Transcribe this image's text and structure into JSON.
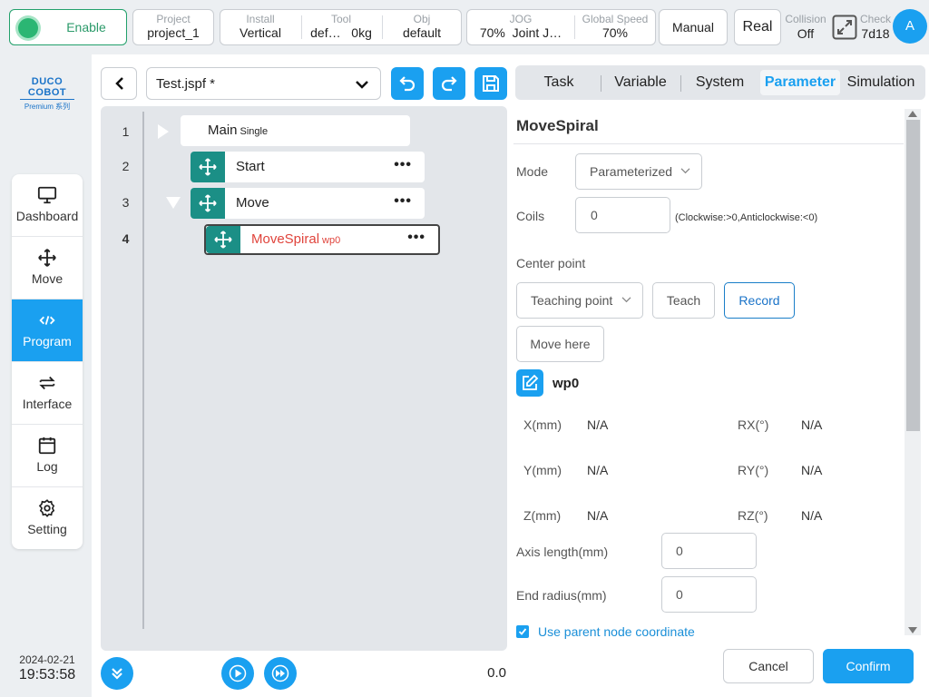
{
  "topbar": {
    "enable_label": "Enable",
    "project": {
      "title": "Project",
      "value": "project_1"
    },
    "install": {
      "title": "Install",
      "value": "Vertical"
    },
    "tool": {
      "title": "Tool",
      "value": "def…",
      "weight": "0kg"
    },
    "obj": {
      "title": "Obj",
      "value": "default"
    },
    "jog": {
      "title": "JOG",
      "value": "70%",
      "mode": "Joint J…"
    },
    "global_speed": {
      "title": "Global Speed",
      "value": "70%"
    },
    "manual_label": "Manual",
    "real_label": "Real",
    "collision": {
      "title": "Collision",
      "value": "Off"
    },
    "check": {
      "title": "Check",
      "value": "7d18"
    },
    "avatar_letter": "A"
  },
  "logo": {
    "brand": "DUCO COBOT",
    "series": "Premium 系列"
  },
  "sidebar": {
    "items": [
      {
        "label": "Dashboard",
        "icon": "monitor-icon"
      },
      {
        "label": "Move",
        "icon": "move-arrows-icon"
      },
      {
        "label": "Program",
        "icon": "code-icon"
      },
      {
        "label": "Interface",
        "icon": "swap-icon"
      },
      {
        "label": "Log",
        "icon": "calendar-icon"
      },
      {
        "label": "Setting",
        "icon": "gear-icon"
      }
    ],
    "active": "Program"
  },
  "datetime": {
    "date": "2024-02-21",
    "time": "19:53:58"
  },
  "program": {
    "file_name": "Test.jspf *",
    "lines": [
      "1",
      "2",
      "3",
      "4"
    ],
    "nodes": [
      {
        "name": "Main",
        "sub": "Single"
      },
      {
        "name": "Start",
        "sub": ""
      },
      {
        "name": "Move",
        "sub": ""
      },
      {
        "name": "MoveSpiral",
        "sub": "wp0"
      }
    ],
    "speed_value": "0.0"
  },
  "tabs": [
    "Task",
    "Variable",
    "System",
    "Parameter",
    "Simulation"
  ],
  "active_tab": "Parameter",
  "params": {
    "title": "MoveSpiral",
    "mode_label": "Mode",
    "mode_value": "Parameterized",
    "coils_label": "Coils",
    "coils_value": "0",
    "coils_hint": "(Clockwise:>0,Anticlockwise:<0)",
    "center_label": "Center point",
    "teaching_point": "Teaching point",
    "teach_label": "Teach",
    "record_label": "Record",
    "move_here_label": "Move here",
    "waypoint": "wp0",
    "coords": [
      {
        "label": "X(mm)",
        "value": "N/A"
      },
      {
        "label": "RX(°)",
        "value": "N/A"
      },
      {
        "label": "Y(mm)",
        "value": "N/A"
      },
      {
        "label": "RY(°)",
        "value": "N/A"
      },
      {
        "label": "Z(mm)",
        "value": "N/A"
      },
      {
        "label": "RZ(°)",
        "value": "N/A"
      }
    ],
    "axis_length_label": "Axis length(mm)",
    "axis_length_value": "0",
    "end_radius_label": "End radius(mm)",
    "end_radius_value": "0",
    "parent_coord_label": "Use parent node coordinate",
    "parent_coord_checked": true
  },
  "footer": {
    "cancel_label": "Cancel",
    "confirm_label": "Confirm"
  },
  "colors": {
    "accent": "#1aa0f0",
    "handle": "#1b8f86",
    "enable": "#2bb673",
    "error_text": "#e0443c"
  }
}
